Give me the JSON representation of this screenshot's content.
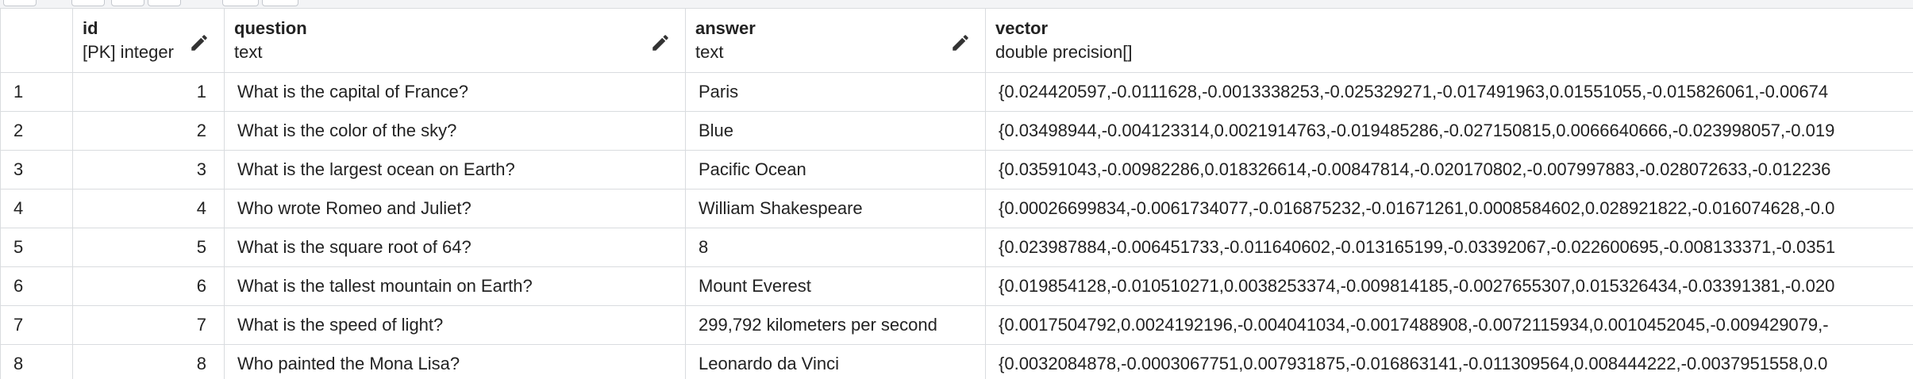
{
  "columns": {
    "id": {
      "name": "id",
      "type": "[PK] integer"
    },
    "question": {
      "name": "question",
      "type": "text"
    },
    "answer": {
      "name": "answer",
      "type": "text"
    },
    "vector": {
      "name": "vector",
      "type": "double precision[]"
    }
  },
  "icons": {
    "edit": "pencil-icon"
  },
  "colors": {
    "border": "#d9dcdf",
    "header_text": "#222222",
    "toolbar_bg": "#f3f4f6"
  },
  "rows": [
    {
      "row": "1",
      "id": "1",
      "question": "What is the capital of France?",
      "answer": "Paris",
      "vector": "{0.024420597,-0.0111628,-0.0013338253,-0.025329271,-0.017491963,0.01551055,-0.015826061,-0.00674"
    },
    {
      "row": "2",
      "id": "2",
      "question": "What is the color of the sky?",
      "answer": "Blue",
      "vector": "{0.03498944,-0.004123314,0.0021914763,-0.019485286,-0.027150815,0.0066640666,-0.023998057,-0.019"
    },
    {
      "row": "3",
      "id": "3",
      "question": "What is the largest ocean on Earth?",
      "answer": "Pacific Ocean",
      "vector": "{0.03591043,-0.00982286,0.018326614,-0.00847814,-0.020170802,-0.007997883,-0.028072633,-0.012236"
    },
    {
      "row": "4",
      "id": "4",
      "question": "Who wrote Romeo and Juliet?",
      "answer": "William Shakespeare",
      "vector": "{0.00026699834,-0.0061734077,-0.016875232,-0.01671261,0.0008584602,0.028921822,-0.016074628,-0.0"
    },
    {
      "row": "5",
      "id": "5",
      "question": "What is the square root of 64?",
      "answer": "8",
      "vector": "{0.023987884,-0.006451733,-0.011640602,-0.013165199,-0.03392067,-0.022600695,-0.008133371,-0.0351"
    },
    {
      "row": "6",
      "id": "6",
      "question": "What is the tallest mountain on Earth?",
      "answer": "Mount Everest",
      "vector": "{0.019854128,-0.010510271,0.0038253374,-0.009814185,-0.0027655307,0.015326434,-0.03391381,-0.020"
    },
    {
      "row": "7",
      "id": "7",
      "question": "What is the speed of light?",
      "answer": "299,792 kilometers per second",
      "vector": "{0.0017504792,0.0024192196,-0.004041034,-0.0017488908,-0.0072115934,0.0010452045,-0.009429079,-"
    },
    {
      "row": "8",
      "id": "8",
      "question": "Who painted the Mona Lisa?",
      "answer": "Leonardo da Vinci",
      "vector": "{0.0032084878,-0.0003067751,0.007931875,-0.016863141,-0.011309564,0.008444222,-0.0037951558,0.0"
    }
  ]
}
